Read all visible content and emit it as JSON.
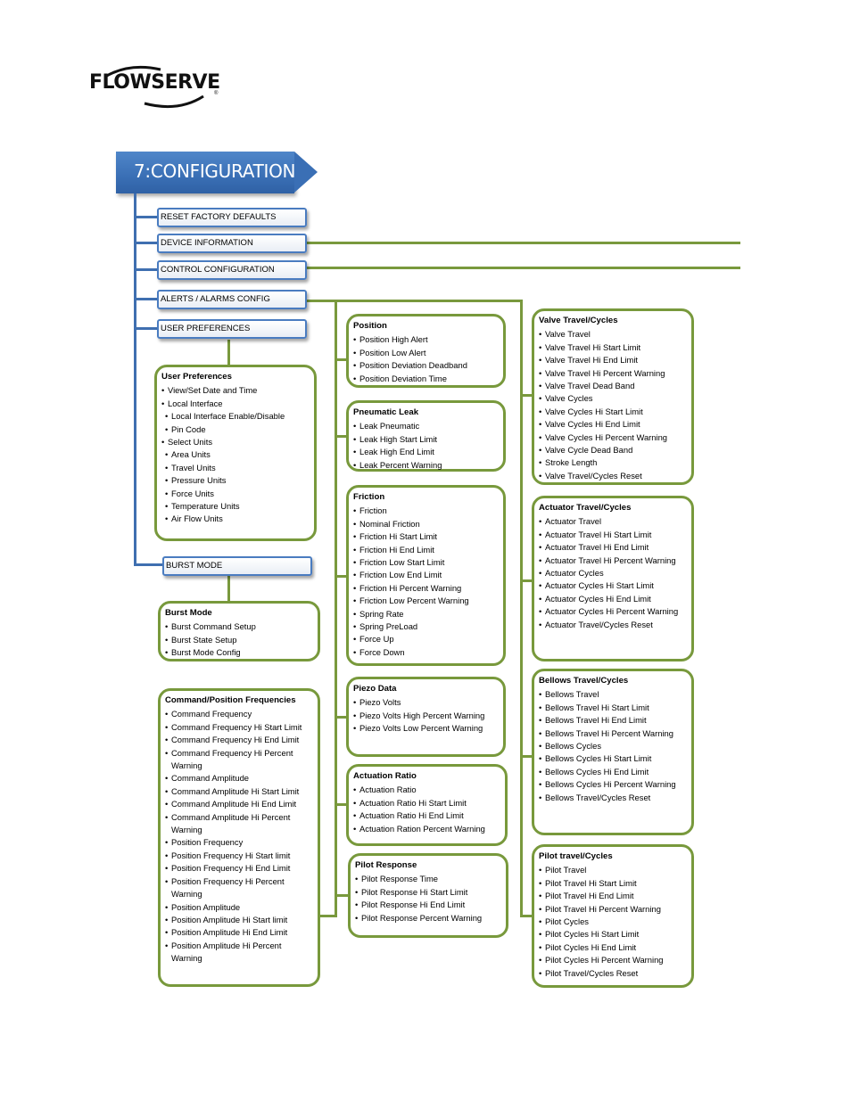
{
  "logo": {
    "text": "FLOWSERVE",
    "registered_mark": "®"
  },
  "header": {
    "title": "7:CONFIGURATION"
  },
  "menu": {
    "items": [
      {
        "label": "RESET FACTORY DEFAULTS"
      },
      {
        "label": "DEVICE INFORMATION"
      },
      {
        "label": "CONTROL CONFIGURATION"
      },
      {
        "label": "ALERTS / ALARMS CONFIG"
      },
      {
        "label": "USER PREFERENCES"
      },
      {
        "label": "BURST MODE"
      }
    ]
  },
  "colors": {
    "header_blue": "#3a6fb5",
    "menu_border": "#4a7cc0",
    "connector_green": "#79993d",
    "connector_blue": "#3f6fb0"
  },
  "boxes": {
    "user_preferences": {
      "title": "User Preferences",
      "items": [
        "View/Set Date and Time",
        "Local Interface",
        "Local Interface Enable/Disable",
        "Pin Code",
        "Select Units",
        "Area Units",
        "Travel Units",
        "Pressure Units",
        "Force Units",
        "Temperature Units",
        "Air Flow Units"
      ]
    },
    "burst_mode": {
      "title": "Burst Mode",
      "items": [
        "Burst Command Setup",
        "Burst State Setup",
        "Burst Mode Config"
      ]
    },
    "command_position": {
      "title": "Command/Position Frequencies",
      "items": [
        "Command Frequency",
        "Command Frequency Hi Start Limit",
        "Command Frequency Hi End Limit",
        "Command Frequency Hi Percent Warning",
        "Command Amplitude",
        "Command Amplitude Hi Start Limit",
        "Command Amplitude Hi End Limit",
        "Command Amplitude Hi Percent Warning",
        "Position Frequency",
        "Position Frequency Hi Start limit",
        "Position Frequency Hi End Limit",
        "Position Frequency Hi Percent Warning",
        "Position Amplitude",
        "Position Amplitude Hi Start limit",
        "Position Amplitude Hi End Limit",
        "Position Amplitude Hi Percent Warning"
      ]
    },
    "position": {
      "title": "Position",
      "items": [
        "Position High Alert",
        "Position Low Alert",
        "Position Deviation Deadband",
        "Position Deviation Time"
      ]
    },
    "pneumatic_leak": {
      "title": "Pneumatic Leak",
      "items": [
        "Leak Pneumatic",
        "Leak High Start Limit",
        "Leak High End Limit",
        "Leak Percent Warning"
      ]
    },
    "friction": {
      "title": "Friction",
      "items": [
        "Friction",
        "Nominal Friction",
        "Friction Hi Start Limit",
        "Friction Hi End Limit",
        "Friction Low Start Limit",
        "Friction Low End Limit",
        "Friction Hi Percent Warning",
        "Friction Low Percent Warning",
        "Spring Rate",
        "Spring PreLoad",
        "Force Up",
        "Force Down"
      ]
    },
    "piezo_data": {
      "title": "Piezo Data",
      "items": [
        "Piezo Volts",
        "Piezo Volts High Percent Warning",
        "Piezo Volts Low Percent Warning"
      ]
    },
    "actuation_ratio": {
      "title": "Actuation Ratio",
      "items": [
        "Actuation Ratio",
        "Actuation Ratio Hi Start Limit",
        "Actuation Ratio Hi End Limit",
        "Actuation Ration Percent Warning"
      ]
    },
    "pilot_response": {
      "title": "Pilot Response",
      "items": [
        "Pilot Response Time",
        "Pilot Response Hi Start Limit",
        "Pilot Response Hi End Limit",
        "Pilot Response Percent Warning"
      ]
    },
    "valve_travel": {
      "title": "Valve Travel/Cycles",
      "items": [
        "Valve Travel",
        "Valve Travel Hi Start Limit",
        "Valve Travel Hi End Limit",
        "Valve Travel Hi Percent Warning",
        "Valve Travel Dead Band",
        "Valve Cycles",
        "Valve Cycles Hi Start Limit",
        "Valve Cycles Hi End Limit",
        "Valve Cycles Hi Percent Warning",
        "Valve Cycle Dead Band",
        "Stroke Length",
        "Valve Travel/Cycles Reset"
      ]
    },
    "actuator_travel": {
      "title": "Actuator Travel/Cycles",
      "items": [
        "Actuator Travel",
        "Actuator Travel Hi Start Limit",
        "Actuator Travel Hi End Limit",
        "Actuator Travel Hi Percent Warning",
        "Actuator Cycles",
        "Actuator Cycles Hi Start Limit",
        "Actuator Cycles Hi End Limit",
        "Actuator Cycles Hi Percent Warning",
        "Actuator Travel/Cycles Reset"
      ]
    },
    "bellows_travel": {
      "title": "Bellows Travel/Cycles",
      "items": [
        "Bellows Travel",
        "Bellows Travel Hi Start Limit",
        "Bellows Travel Hi End Limit",
        "Bellows Travel Hi Percent Warning",
        "Bellows Cycles",
        "Bellows Cycles Hi Start Limit",
        "Bellows Cycles Hi End Limit",
        "Bellows Cycles Hi Percent Warning",
        "Bellows Travel/Cycles Reset"
      ]
    },
    "pilot_travel": {
      "title": "Pilot travel/Cycles",
      "items": [
        "Pilot Travel",
        "Pilot Travel Hi Start Limit",
        "Pilot Travel Hi End Limit",
        "Pilot Travel Hi Percent Warning",
        "Pilot Cycles",
        "Pilot Cycles Hi Start Limit",
        "Pilot Cycles Hi End Limit",
        "Pilot Cycles Hi Percent Warning",
        "Pilot Travel/Cycles Reset"
      ]
    }
  }
}
